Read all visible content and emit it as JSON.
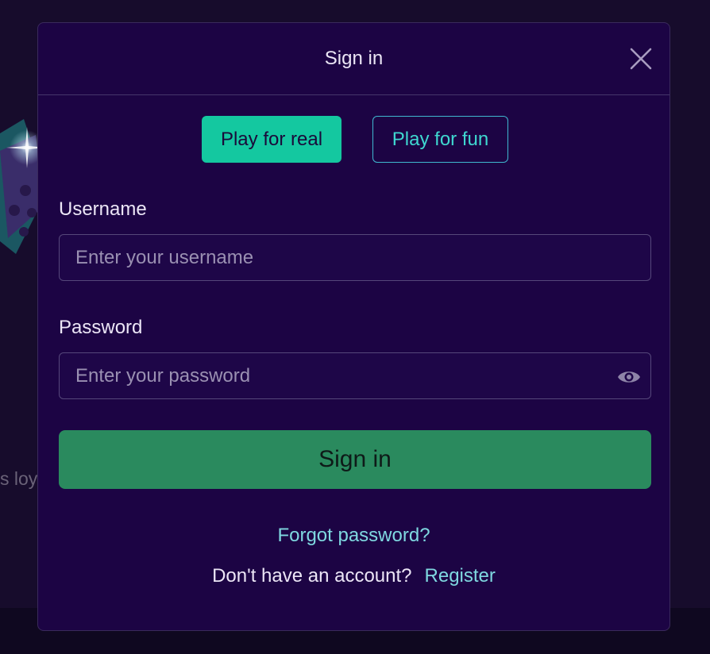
{
  "background": {
    "partial_text": "s loy"
  },
  "modal": {
    "title": "Sign in",
    "close_icon": "close-icon"
  },
  "mode_tabs": [
    {
      "label": "Play for real",
      "active": true
    },
    {
      "label": "Play for fun",
      "active": false
    }
  ],
  "form": {
    "username": {
      "label": "Username",
      "placeholder": "Enter your username",
      "value": ""
    },
    "password": {
      "label": "Password",
      "placeholder": "Enter your password",
      "value": "",
      "toggle_icon": "eye-icon"
    },
    "submit_label": "Sign in"
  },
  "footer": {
    "forgot_label": "Forgot password?",
    "no_account_text": "Don't have an account?",
    "register_label": "Register"
  },
  "colors": {
    "modal_bg": "#1c0444",
    "accent_teal": "#14c8a0",
    "signin_green": "#2a8a5e",
    "link_cyan": "#7fd8e0"
  }
}
